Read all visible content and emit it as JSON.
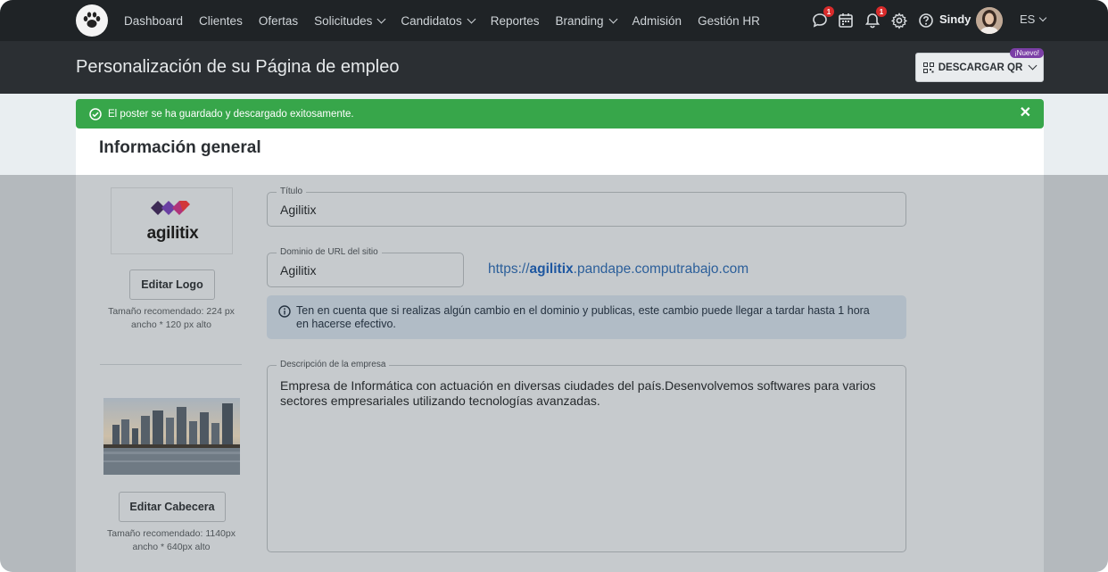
{
  "nav": {
    "items": [
      {
        "label": "Dashboard",
        "dropdown": false
      },
      {
        "label": "Clientes",
        "dropdown": false
      },
      {
        "label": "Ofertas",
        "dropdown": false
      },
      {
        "label": "Solicitudes",
        "dropdown": true
      },
      {
        "label": "Candidatos",
        "dropdown": true
      },
      {
        "label": "Reportes",
        "dropdown": false
      },
      {
        "label": "Branding",
        "dropdown": true
      },
      {
        "label": "Admisión",
        "dropdown": false
      },
      {
        "label": "Gestión HR",
        "dropdown": false
      }
    ],
    "chat_badge": "1",
    "notification_badge": "1",
    "user_name": "Sindy",
    "language": "ES"
  },
  "header": {
    "title": "Personalización de su Página de empleo",
    "qr_button_label": "DESCARGAR QR",
    "new_tag": "¡Nuevo!"
  },
  "alert": {
    "message": "El poster se ha guardado y descargado exitosamente.",
    "color": "#37a64a"
  },
  "section": {
    "title": "Información general"
  },
  "logo_panel": {
    "brand_text": "agilitix",
    "edit_logo_label": "Editar Logo",
    "logo_hint_line1": "Tamaño recomendado: 224 px",
    "logo_hint_line2": "ancho * 120 px alto",
    "edit_banner_label": "Editar Cabecera",
    "banner_hint_line1": "Tamaño recomendado: 1140px",
    "banner_hint_line2": "ancho * 640px alto"
  },
  "form": {
    "title_label": "Título",
    "title_value": "Agilitix",
    "domain_label": "Dominio de URL del sitio",
    "domain_value": "Agilitix",
    "url_prefix": "https://",
    "url_domain": "agilitix",
    "url_suffix": ".pandape.computrabajo.com",
    "info_line1": "Ten en cuenta que si realizas algún cambio en el dominio y publicas, este cambio puede llegar a tardar hasta 1 hora",
    "info_line2": "en hacerse efectivo.",
    "description_label": "Descripción de la empresa",
    "description_value": "Empresa de Informática con actuación en diversas ciudades del país.Desenvolvemos softwares para varios sectores empresariales utilizando tecnologías avanzadas."
  }
}
